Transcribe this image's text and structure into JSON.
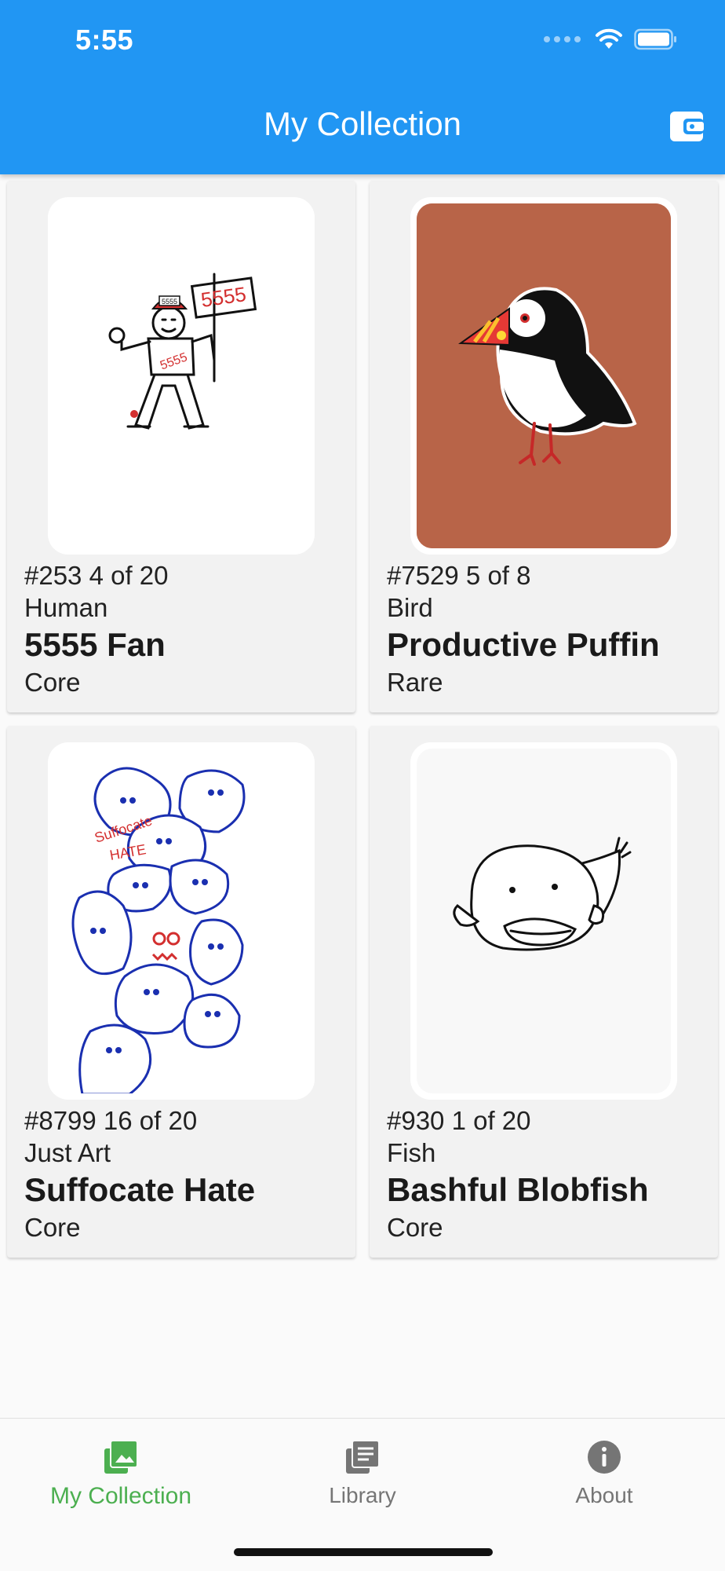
{
  "status_bar": {
    "time": "5:55"
  },
  "app_bar": {
    "title": "My Collection",
    "action_icon": "wallet-icon"
  },
  "colors": {
    "primary": "#2196F3",
    "active_tab": "#4CAF50",
    "inactive_tab": "#757575",
    "card_bg": "#f2f2f2",
    "puffin_bg": "#B86448"
  },
  "cards": [
    {
      "number_line": "#253 4 of 20",
      "category": "Human",
      "name": "5555 Fan",
      "rarity": "Core",
      "art": "stick-figure-with-5555-sign"
    },
    {
      "number_line": "#7529 5 of 8",
      "category": "Bird",
      "name": "Productive Puffin",
      "rarity": "Rare",
      "art": "puffin"
    },
    {
      "number_line": "#8799 16 of 20",
      "category": "Just Art",
      "name": "Suffocate Hate",
      "rarity": "Core",
      "art": "blue-blob-faces"
    },
    {
      "number_line": "#930 1 of 20",
      "category": "Fish",
      "name": "Bashful Blobfish",
      "rarity": "Core",
      "art": "blobfish"
    }
  ],
  "art_text": {
    "sign": "5555",
    "shirt": "5555",
    "cap": "5555",
    "doodle_1": "Suffocate",
    "doodle_2": "HATE"
  },
  "bottom_nav": [
    {
      "label": "My Collection",
      "icon": "collection-icon",
      "active": true
    },
    {
      "label": "Library",
      "icon": "library-icon",
      "active": false
    },
    {
      "label": "About",
      "icon": "info-icon",
      "active": false
    }
  ]
}
